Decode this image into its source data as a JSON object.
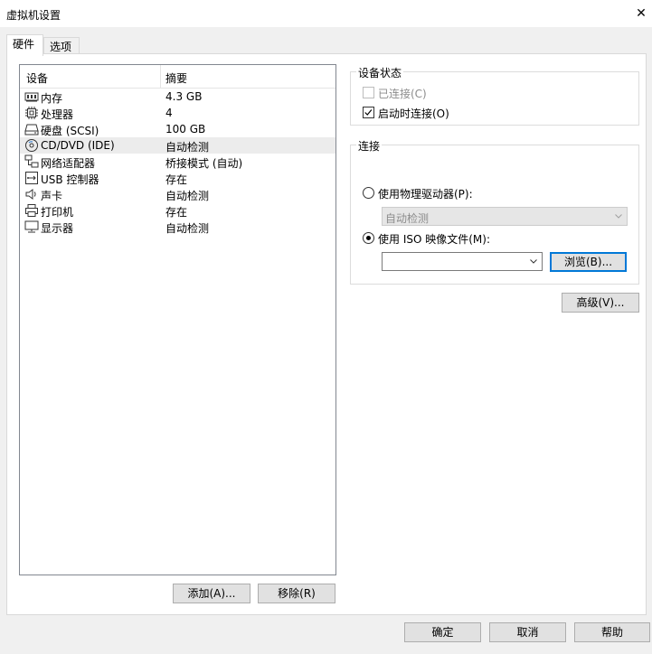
{
  "window": {
    "title": "虚拟机设置",
    "close_label": "✕"
  },
  "tabs": [
    {
      "label": "硬件",
      "active": true
    },
    {
      "label": "选项",
      "active": false
    }
  ],
  "device_list": {
    "header": {
      "device": "设备",
      "summary": "摘要"
    },
    "rows": [
      {
        "name": "内存",
        "summary": "4.3 GB",
        "icon": "memory-icon",
        "selected": false
      },
      {
        "name": "处理器",
        "summary": "4",
        "icon": "processor-icon",
        "selected": false
      },
      {
        "name": "硬盘 (SCSI)",
        "summary": "100 GB",
        "icon": "hard-disk-icon",
        "selected": false
      },
      {
        "name": "CD/DVD (IDE)",
        "summary": "自动检测",
        "icon": "cd-dvd-icon",
        "selected": true
      },
      {
        "name": "网络适配器",
        "summary": "桥接模式 (自动)",
        "icon": "network-adapter-icon",
        "selected": false
      },
      {
        "name": "USB 控制器",
        "summary": "存在",
        "icon": "usb-icon",
        "selected": false
      },
      {
        "name": "声卡",
        "summary": "自动检测",
        "icon": "speaker-icon",
        "selected": false
      },
      {
        "name": "打印机",
        "summary": "存在",
        "icon": "printer-icon",
        "selected": false
      },
      {
        "name": "显示器",
        "summary": "自动检测",
        "icon": "monitor-icon",
        "selected": false
      }
    ]
  },
  "left_buttons": {
    "add": "添加(A)...",
    "remove": "移除(R)"
  },
  "device_status": {
    "title": "设备状态",
    "connected": {
      "label": "已连接(C)",
      "checked": false,
      "disabled": true
    },
    "connect_at_power_on": {
      "label": "启动时连接(O)",
      "checked": true,
      "disabled": false
    }
  },
  "connection": {
    "title": "连接",
    "physical": {
      "label": "使用物理驱动器(P):",
      "selected": false
    },
    "physical_combo": {
      "value": "自动检测",
      "disabled": true
    },
    "iso": {
      "label": "使用 ISO 映像文件(M):",
      "selected": true
    },
    "iso_combo": {
      "value": ""
    },
    "browse": "浏览(B)..."
  },
  "advanced_button": "高级(V)...",
  "footer": {
    "ok": "确定",
    "cancel": "取消",
    "help": "帮助"
  }
}
